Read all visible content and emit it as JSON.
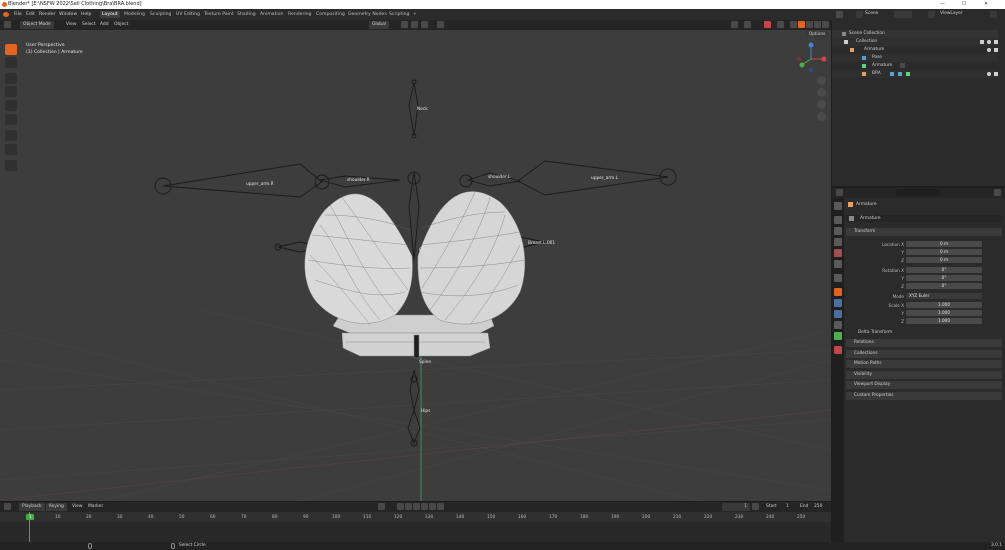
{
  "window": {
    "title": "Blender* [E:\\NSFW 2022\\Sell Clothing\\Bra\\BRA.blend]",
    "minimize": "—",
    "maximize": "☐",
    "close": "✕"
  },
  "menu": [
    "File",
    "Edit",
    "Render",
    "Window",
    "Help"
  ],
  "workspaces": [
    "Layout",
    "Modeling",
    "Sculpting",
    "UV Editing",
    "Texture Paint",
    "Shading",
    "Animation",
    "Rendering",
    "Compositing",
    "Geometry Nodes",
    "Scripting"
  ],
  "workspace_add": "+",
  "viewport_header": {
    "mode": "Object Mode",
    "menus": [
      "View",
      "Select",
      "Add",
      "Object"
    ],
    "orientation": "Global",
    "options": "Options"
  },
  "viewport": {
    "perspective": "User Perspective",
    "context": "(1) Collection | Armature"
  },
  "bones": {
    "neck": "Neck",
    "upper_arm_r": "upper_arm.R",
    "shoulder_r": "shoulder.R",
    "shoulder_l": "shoulder.L",
    "upper_arm_l": "upper_arm.L",
    "chest": "Ch",
    "breast_l": "Breast.L.001",
    "spine": "Spine",
    "hips": "Hips"
  },
  "timeline_header": {
    "playback": "Playback",
    "keying": "Keying",
    "view": "View",
    "marker": "Marker",
    "current_frame": "1",
    "start_label": "Start",
    "start": "1",
    "end_label": "End",
    "end": "250"
  },
  "timeline_ticks": [
    "1",
    "10",
    "20",
    "30",
    "40",
    "50",
    "60",
    "70",
    "80",
    "90",
    "100",
    "110",
    "120",
    "130",
    "140",
    "150",
    "160",
    "170",
    "180",
    "190",
    "200",
    "210",
    "220",
    "230",
    "240",
    "250"
  ],
  "status_bar": {
    "action": "Select Circle",
    "version": "3.0.1"
  },
  "outliner_header": {
    "scene": "Scene",
    "view_layer": "ViewLayer"
  },
  "outliner": {
    "items": [
      {
        "label": "Scene Collection"
      },
      {
        "label": "Collection"
      },
      {
        "label": "Armature"
      },
      {
        "label": "Pose"
      },
      {
        "label": "Armature"
      },
      {
        "label": "BRA"
      }
    ]
  },
  "properties": {
    "object_name": "Armature",
    "data_name": "Armature",
    "transform": "Transform",
    "location_label": "Location X",
    "location": [
      "0 m",
      "0 m",
      "0 m"
    ],
    "rotation_label": "Rotation X",
    "rotation": [
      "0°",
      "0°",
      "0°"
    ],
    "mode_label": "Mode",
    "mode": "XYZ Euler",
    "scale_label": "Scale X",
    "scale": [
      "1.000",
      "1.000",
      "1.000"
    ],
    "y": "Y",
    "z": "Z",
    "delta": "Delta Transform",
    "panels": [
      "Relations",
      "Collections",
      "Motion Paths",
      "Visibility",
      "Viewport Display",
      "Custom Properties"
    ]
  },
  "colors": {
    "accent": "#e06520",
    "bone": "#1a1a1a",
    "mesh": "#d9d9d9",
    "timeline_cursor": "#3fae3f"
  }
}
